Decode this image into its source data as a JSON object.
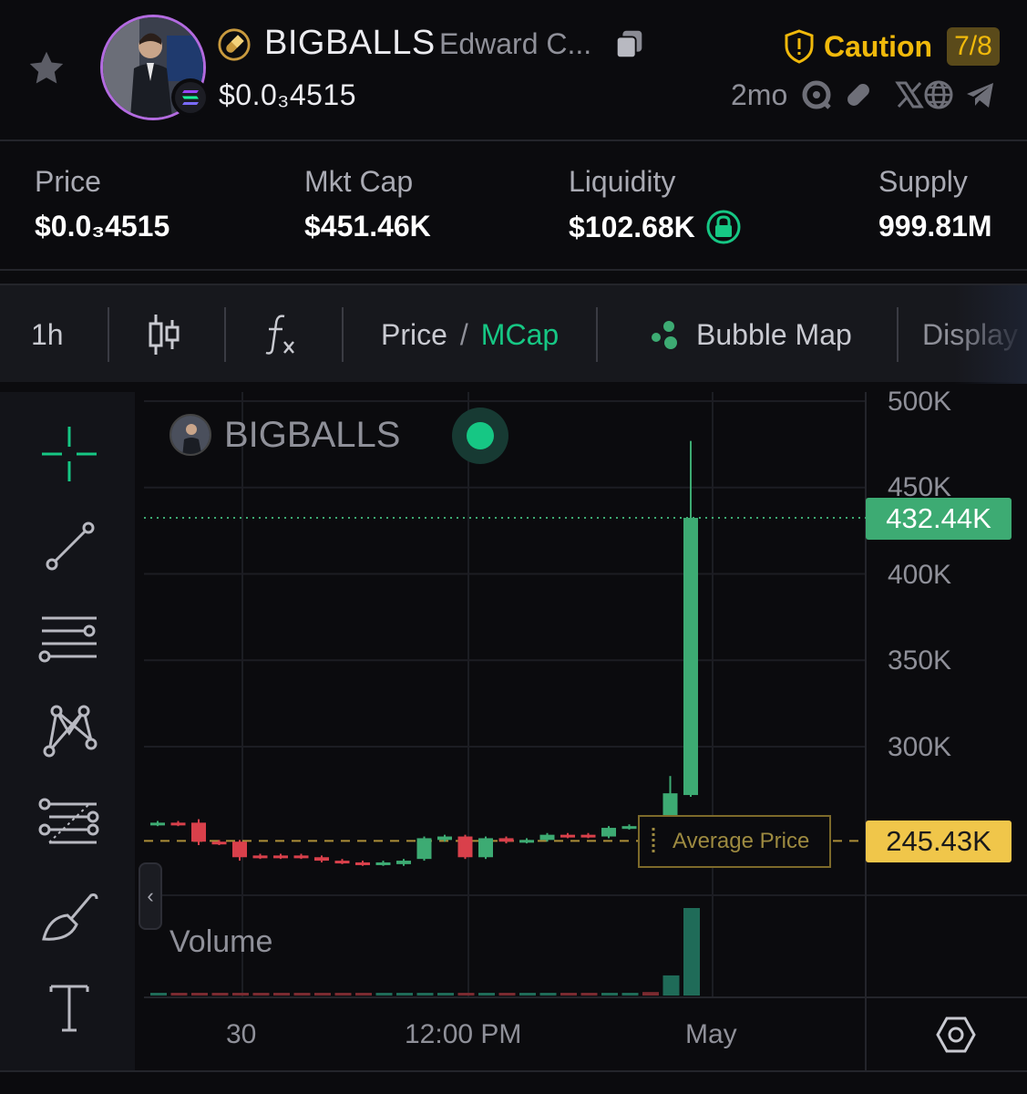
{
  "header": {
    "symbol": "BIGBALLS",
    "name": "Edward C...",
    "price": "$0.0₃4515",
    "age": "2mo",
    "caution_label": "Caution",
    "caution_score": "7/8",
    "icons": [
      "star-icon",
      "pill-icon",
      "copy-icon",
      "solana-icon",
      "shield-icon",
      "search-icon",
      "pill-outline-icon",
      "x-icon",
      "globe-icon",
      "telegram-icon"
    ]
  },
  "stats": [
    {
      "label": "Price",
      "value": "$0.0₃4515"
    },
    {
      "label": "Mkt Cap",
      "value": "$451.46K"
    },
    {
      "label": "Liquidity",
      "value": "$102.68K",
      "locked": true
    },
    {
      "label": "Supply",
      "value": "999.81M"
    }
  ],
  "toolbar": {
    "interval": "1h",
    "price_label": "Price",
    "slash": "/",
    "mcap_label": "MCap",
    "bubble_map": "Bubble Map",
    "display": "Display"
  },
  "chart": {
    "legend_symbol": "BIGBALLS",
    "volume_label": "Volume",
    "avg_price_label": "Average Price",
    "current_tag": "432.44K",
    "avg_tag": "245.43K",
    "colors": {
      "up": "#3dab73",
      "down": "#d9404b",
      "avg": "#f0c64a",
      "current": "#3dab73"
    }
  },
  "chart_data": {
    "type": "candlestick",
    "y_unit": "Market cap (USD)",
    "ylim": [
      200000,
      505000
    ],
    "y_ticks": [
      "500K",
      "450K",
      "400K",
      "350K",
      "300K"
    ],
    "x_ticks": [
      "30",
      "12:00 PM",
      "May"
    ],
    "current_value": 432440,
    "average_price": 245430,
    "candles": [
      {
        "o": 255000,
        "c": 256000,
        "h": 257000,
        "l": 254000
      },
      {
        "o": 256000,
        "c": 255000,
        "h": 257000,
        "l": 254000
      },
      {
        "o": 256000,
        "c": 245000,
        "h": 258000,
        "l": 243000
      },
      {
        "o": 245000,
        "c": 244000,
        "h": 246000,
        "l": 243000
      },
      {
        "o": 245000,
        "c": 236000,
        "h": 246000,
        "l": 234000
      },
      {
        "o": 237000,
        "c": 236000,
        "h": 238000,
        "l": 235000
      },
      {
        "o": 237000,
        "c": 236000,
        "h": 238000,
        "l": 235000
      },
      {
        "o": 237000,
        "c": 236000,
        "h": 238000,
        "l": 235000
      },
      {
        "o": 236000,
        "c": 234000,
        "h": 237000,
        "l": 233000
      },
      {
        "o": 234000,
        "c": 233000,
        "h": 235000,
        "l": 232000
      },
      {
        "o": 233000,
        "c": 232000,
        "h": 234000,
        "l": 231000
      },
      {
        "o": 232000,
        "c": 233000,
        "h": 234000,
        "l": 231000
      },
      {
        "o": 232000,
        "c": 234000,
        "h": 235000,
        "l": 231000
      },
      {
        "o": 235000,
        "c": 247000,
        "h": 248000,
        "l": 234000
      },
      {
        "o": 246000,
        "c": 248000,
        "h": 249000,
        "l": 245000
      },
      {
        "o": 248000,
        "c": 236000,
        "h": 249000,
        "l": 235000
      },
      {
        "o": 236000,
        "c": 247000,
        "h": 248000,
        "l": 235000
      },
      {
        "o": 247000,
        "c": 245000,
        "h": 248000,
        "l": 244000
      },
      {
        "o": 245000,
        "c": 246000,
        "h": 247000,
        "l": 244000
      },
      {
        "o": 246000,
        "c": 249000,
        "h": 250000,
        "l": 245000
      },
      {
        "o": 249000,
        "c": 248000,
        "h": 250000,
        "l": 247000
      },
      {
        "o": 249000,
        "c": 248000,
        "h": 250000,
        "l": 247000
      },
      {
        "o": 248000,
        "c": 253000,
        "h": 254000,
        "l": 247000
      },
      {
        "o": 253000,
        "c": 254000,
        "h": 255000,
        "l": 252000
      },
      {
        "o": 255000,
        "c": 240000,
        "h": 256000,
        "l": 239000
      },
      {
        "o": 240000,
        "c": 273000,
        "h": 283000,
        "l": 238000
      },
      {
        "o": 272000,
        "c": 432440,
        "h": 477000,
        "l": 271000
      }
    ],
    "volume": [
      0.02,
      0.02,
      0.02,
      0.02,
      0.02,
      0.02,
      0.02,
      0.02,
      0.02,
      0.02,
      0.02,
      0.02,
      0.02,
      0.02,
      0.02,
      0.02,
      0.02,
      0.02,
      0.02,
      0.02,
      0.02,
      0.02,
      0.02,
      0.02,
      0.04,
      0.23,
      1.0
    ]
  }
}
